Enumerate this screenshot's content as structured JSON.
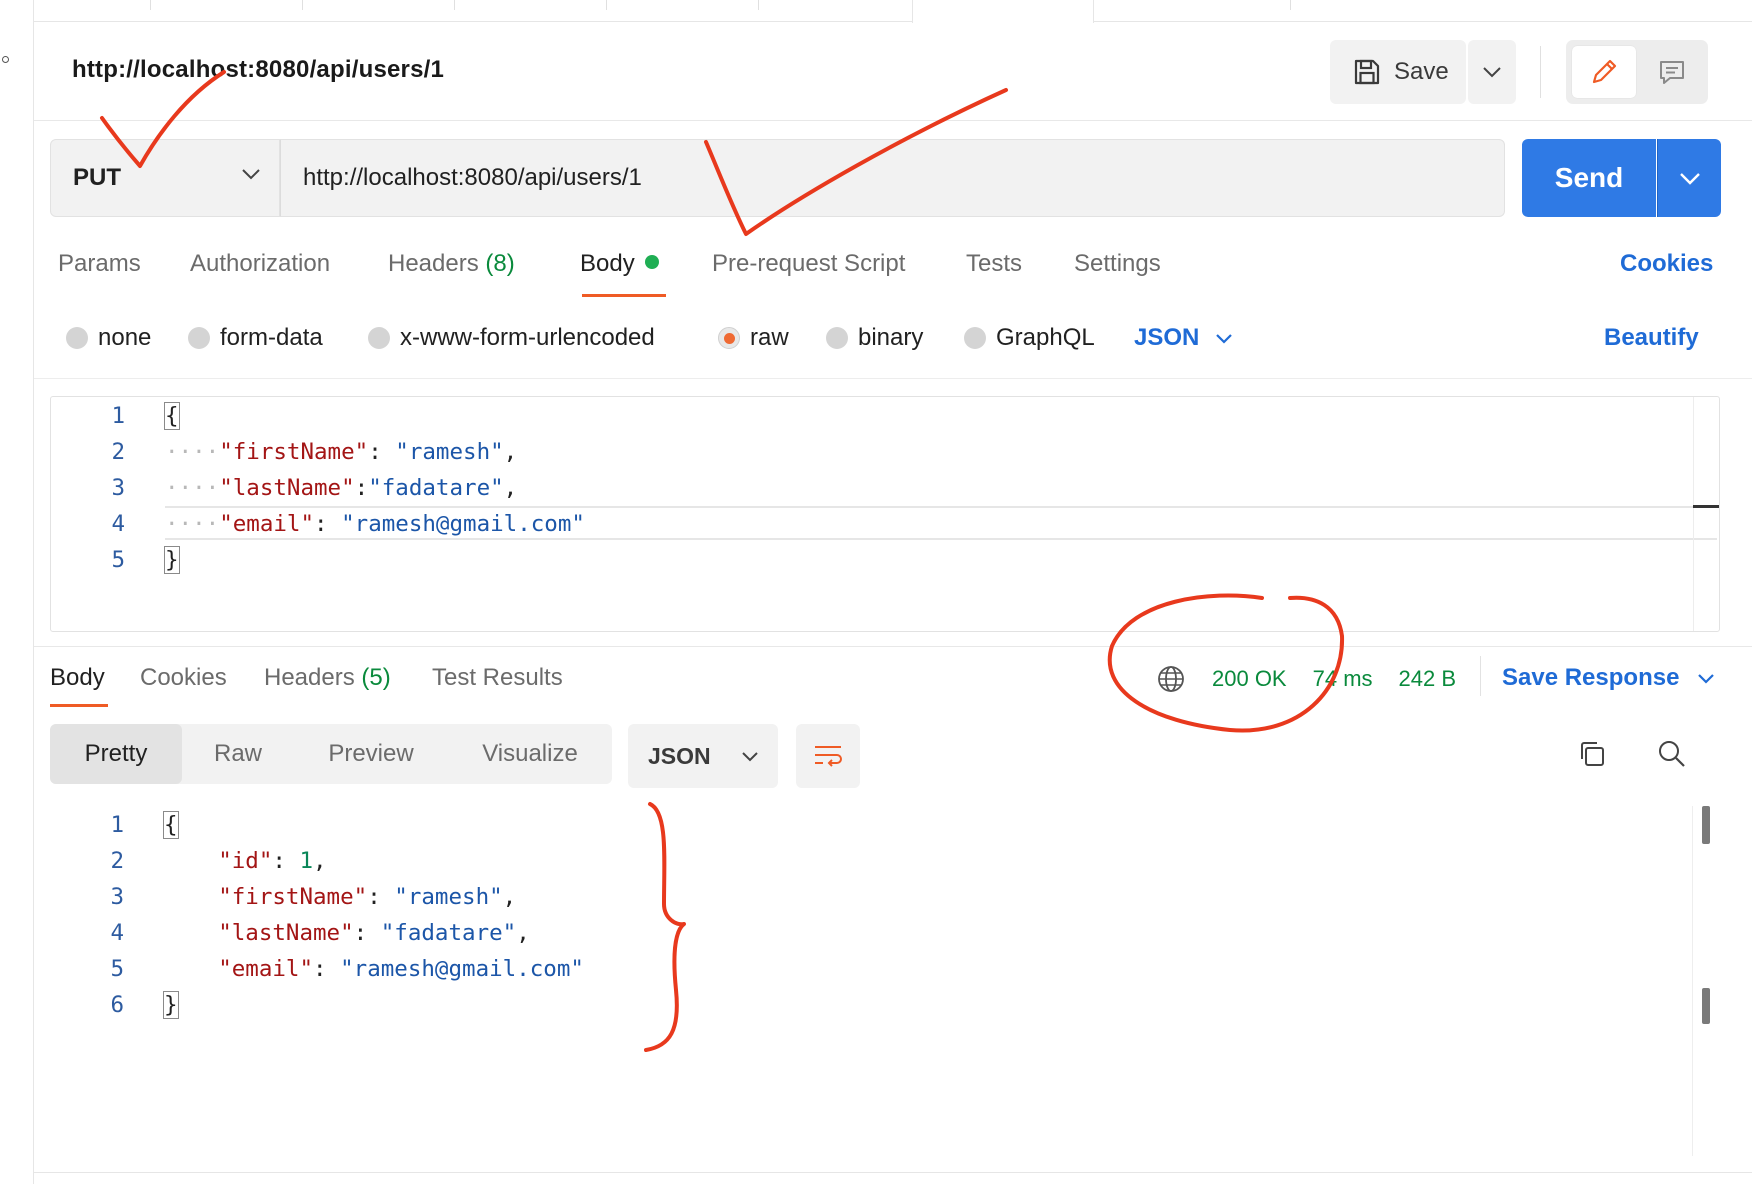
{
  "request": {
    "name": "http://localhost:8080/api/users/1",
    "method": "PUT",
    "url": "http://localhost:8080/api/users/1",
    "send_label": "Send",
    "save_label": "Save"
  },
  "request_tabs": {
    "params": "Params",
    "authorization": "Authorization",
    "headers": "Headers",
    "headers_count": "(8)",
    "body": "Body",
    "prerequest": "Pre-request Script",
    "tests": "Tests",
    "settings": "Settings",
    "cookies": "Cookies"
  },
  "body_types": {
    "none": "none",
    "form_data": "form-data",
    "urlencoded": "x-www-form-urlencoded",
    "raw": "raw",
    "binary": "binary",
    "graphql": "GraphQL",
    "format": "JSON",
    "beautify": "Beautify",
    "selected": "raw"
  },
  "request_body": {
    "line_numbers": [
      "1",
      "2",
      "3",
      "4",
      "5"
    ],
    "open_brace": "{",
    "close_brace": "}",
    "fields": [
      {
        "key": "\"firstName\"",
        "sep": ": ",
        "value": "\"ramesh\"",
        "trail": ","
      },
      {
        "key": "\"lastName\"",
        "sep": ":",
        "value": "\"fadatare\"",
        "trail": ","
      },
      {
        "key": "\"email\"",
        "sep": ": ",
        "value": "\"ramesh@gmail.com\"",
        "trail": ""
      }
    ]
  },
  "response_tabs": {
    "body": "Body",
    "cookies": "Cookies",
    "headers": "Headers",
    "headers_count": "(5)",
    "test_results": "Test Results"
  },
  "response_status": {
    "status": "200 OK",
    "time": "74 ms",
    "size": "242 B",
    "save_response": "Save Response"
  },
  "response_view": {
    "pretty": "Pretty",
    "raw": "Raw",
    "preview": "Preview",
    "visualize": "Visualize",
    "format": "JSON"
  },
  "response_body": {
    "line_numbers": [
      "1",
      "2",
      "3",
      "4",
      "5",
      "6"
    ],
    "open_brace": "{",
    "close_brace": "}",
    "id_key": "\"id\"",
    "id_value": "1",
    "fields": [
      {
        "key": "\"firstName\"",
        "value": "\"ramesh\"",
        "trail": ","
      },
      {
        "key": "\"lastName\"",
        "value": "\"fadatare\"",
        "trail": ","
      },
      {
        "key": "\"email\"",
        "value": "\"ramesh@gmail.com\"",
        "trail": ""
      }
    ]
  },
  "colors": {
    "accent_blue": "#2f7ae5",
    "link_blue": "#1f6bd6",
    "active_orange": "#ef5b25",
    "success_green": "#0a8a3c",
    "annotation_red": "#e8391d"
  },
  "icons": [
    "save-icon",
    "chevron-down-icon",
    "pencil-icon",
    "comment-icon",
    "globe-icon",
    "copy-icon",
    "search-icon",
    "wrap-lines-icon"
  ]
}
